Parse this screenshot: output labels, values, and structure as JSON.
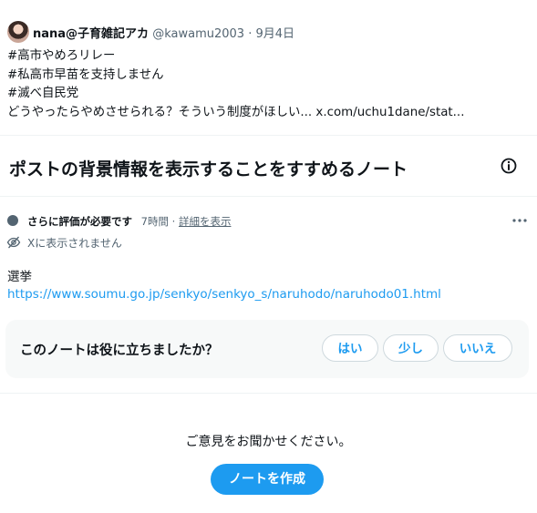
{
  "tweet": {
    "display_name": "nana@子育雑記アカ",
    "handle": "@kawamu2003",
    "separator": "·",
    "date": "9月4日",
    "lines": [
      "#高市やめろリレー",
      "#私高市早苗を支持しません",
      "#滅べ自民党"
    ],
    "last_line_text": "どうやったらやめさせられる？そういう制度がほしい...",
    "last_line_link": "x.com/uchu1dane/stat..."
  },
  "note_prompt": {
    "title": "ポストの背景情報を表示することをすすめるノート",
    "info_icon": "info-icon"
  },
  "note": {
    "status": "さらに評価が必要です",
    "time": "7時間",
    "dot": "·",
    "detail_link": "詳細を表示",
    "visibility": "Xに表示されません",
    "body": "選挙",
    "link": "https://www.soumu.go.jp/senkyo/senkyo_s/naruhodo/naruhodo01.html",
    "status_color": "#536471"
  },
  "rating": {
    "question": "このノートは役に立ちましたか？",
    "options": [
      "はい",
      "少し",
      "いいえ"
    ]
  },
  "footer": {
    "feedback": "ご意見をお聞かせください。",
    "cta": "ノートを作成"
  },
  "colors": {
    "accent": "#1d9bf0",
    "text": "#0f1419",
    "muted": "#536471",
    "panel": "#f7f9f9"
  }
}
